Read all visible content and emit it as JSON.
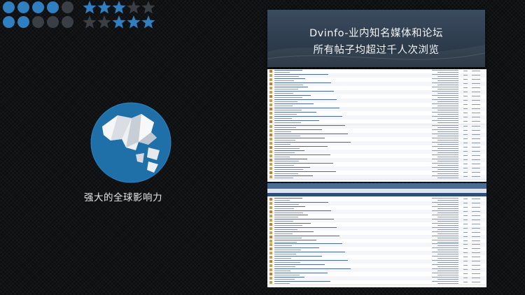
{
  "banner": {
    "line1": "Dvinfo-业内知名媒体和论坛",
    "line2": "所有帖子均超过千人次浏览"
  },
  "caption": "强大的全球影响力",
  "colors": {
    "accent_blue": "#2f7fc1",
    "dark_dot": "#3a3f45",
    "banner": "#2e3c4b",
    "globe_ocean": "#1f6fa8"
  },
  "decor": {
    "dots": {
      "rows": 2,
      "cols": 5,
      "filled": [
        [
          true,
          true,
          true,
          true,
          false
        ],
        [
          true,
          true,
          false,
          false,
          false
        ]
      ]
    },
    "stars": {
      "rows": 2,
      "cols": 5,
      "filled": [
        [
          true,
          true,
          true,
          false,
          false
        ],
        [
          false,
          false,
          true,
          true,
          true
        ]
      ]
    }
  },
  "icons": [
    "globe-icon",
    "star-icon",
    "dot-icon"
  ],
  "forum_screenshot_1": {
    "rows": 26
  },
  "forum_screenshot_2": {
    "rows": 21
  }
}
